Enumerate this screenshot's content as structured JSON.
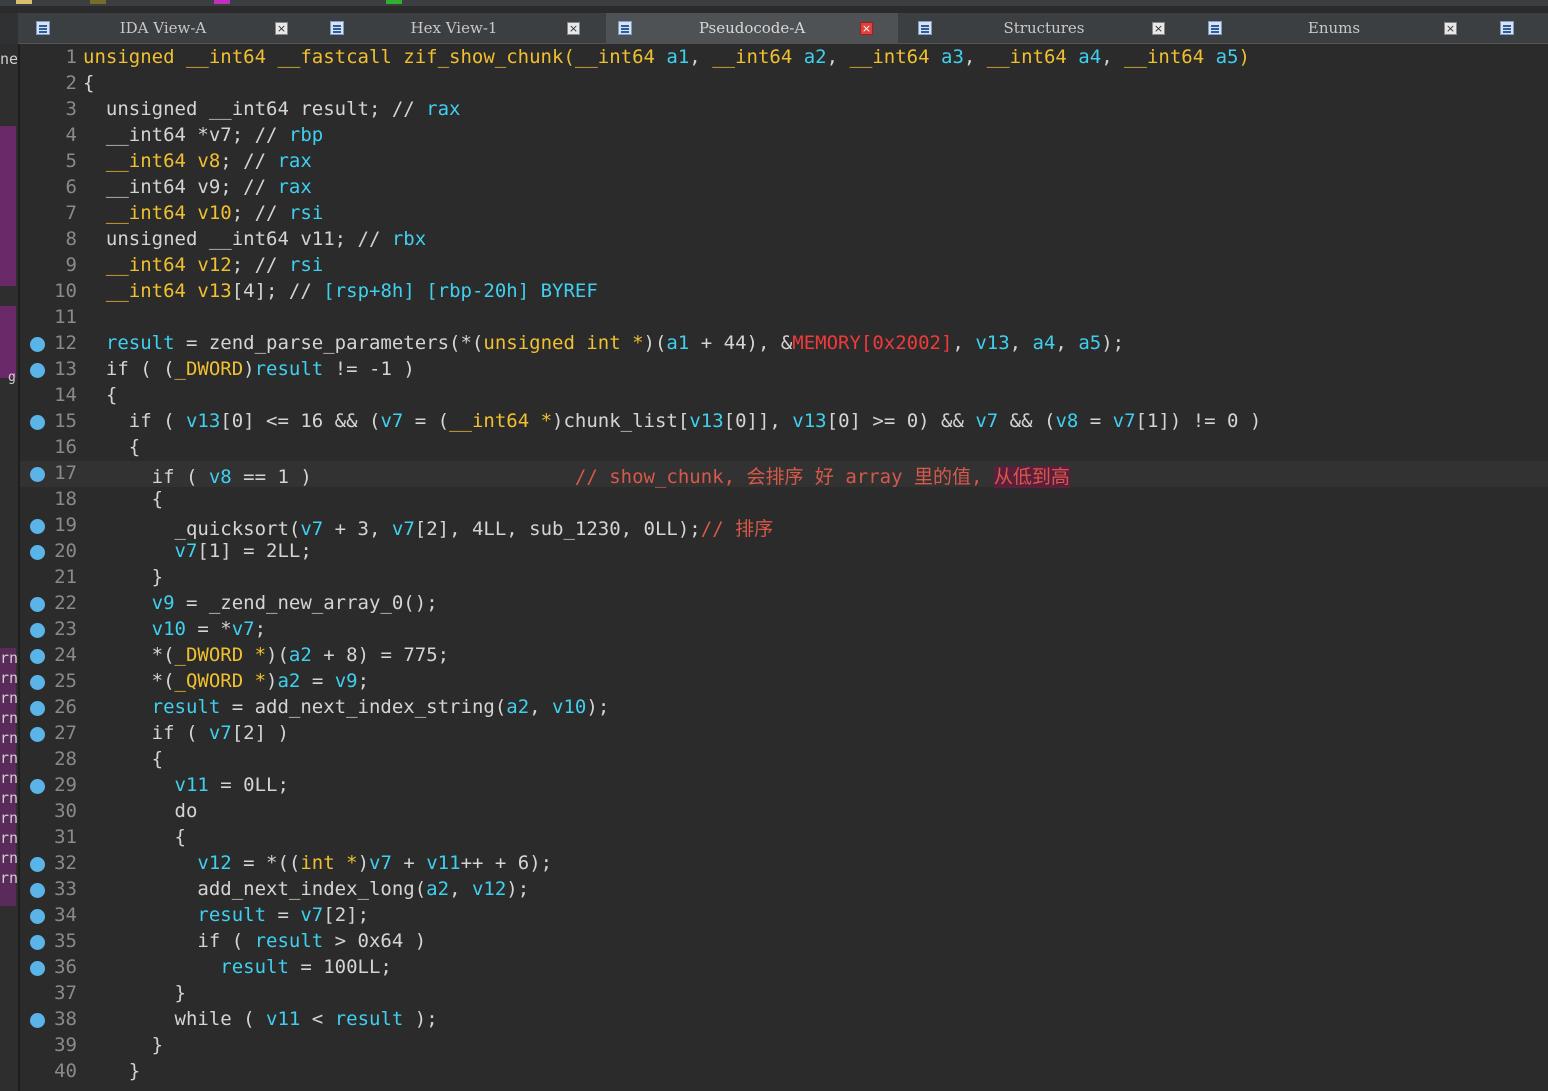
{
  "colors": {
    "background": "#2b2b2b",
    "keyword": "#f0c030",
    "variable": "#3fd0f0",
    "text": "#d4d4d4",
    "memory": "#f03a3a",
    "comment": "#d8584a",
    "breakpoint": "#5ab4e8"
  },
  "tabs": [
    {
      "label": "IDA View-A",
      "icon": "disassembly-icon",
      "active": false
    },
    {
      "label": "Hex View-1",
      "icon": "hex-icon",
      "active": false
    },
    {
      "label": "Pseudocode-A",
      "icon": "pseudocode-icon",
      "active": true
    },
    {
      "label": "Structures",
      "icon": "structures-icon",
      "active": false
    },
    {
      "label": "Enums",
      "icon": "enums-icon",
      "active": false
    }
  ],
  "left_panel_fragments": [
    "ne",
    "g",
    "rn",
    "rn",
    "rn",
    "rn",
    "rn",
    "rn",
    "rn",
    "rn",
    "rn",
    "rn",
    "rn",
    "rn"
  ],
  "code_lines": [
    {
      "n": "1",
      "dot": false,
      "tokens": [
        [
          "y",
          "unsigned __int64 __fastcall zif_show_chunk("
        ],
        [
          "y",
          "__int64 "
        ],
        [
          "c",
          "a1"
        ],
        [
          "w",
          ", "
        ],
        [
          "y",
          "__int64 "
        ],
        [
          "c",
          "a2"
        ],
        [
          "w",
          ", "
        ],
        [
          "y",
          "__int64 "
        ],
        [
          "c",
          "a3"
        ],
        [
          "w",
          ", "
        ],
        [
          "y",
          "__int64 "
        ],
        [
          "c",
          "a4"
        ],
        [
          "w",
          ", "
        ],
        [
          "y",
          "__int64 "
        ],
        [
          "c",
          "a5"
        ],
        [
          "y",
          ")"
        ]
      ]
    },
    {
      "n": "2",
      "dot": false,
      "tokens": [
        [
          "w",
          "{"
        ]
      ]
    },
    {
      "n": "3",
      "dot": false,
      "tokens": [
        [
          "w",
          "  unsigned __int64 result; // "
        ],
        [
          "c",
          "rax"
        ]
      ]
    },
    {
      "n": "4",
      "dot": false,
      "tokens": [
        [
          "w",
          "  __int64 *v7; // "
        ],
        [
          "c",
          "rbp"
        ]
      ]
    },
    {
      "n": "5",
      "dot": false,
      "tokens": [
        [
          "w",
          "  "
        ],
        [
          "y",
          "__int64 v8"
        ],
        [
          "w",
          "; // "
        ],
        [
          "c",
          "rax"
        ]
      ]
    },
    {
      "n": "6",
      "dot": false,
      "tokens": [
        [
          "w",
          "  __int64 v9; // "
        ],
        [
          "c",
          "rax"
        ]
      ]
    },
    {
      "n": "7",
      "dot": false,
      "tokens": [
        [
          "w",
          "  "
        ],
        [
          "y",
          "__int64 v10"
        ],
        [
          "w",
          "; // "
        ],
        [
          "c",
          "rsi"
        ]
      ]
    },
    {
      "n": "8",
      "dot": false,
      "tokens": [
        [
          "w",
          "  unsigned __int64 v11; // "
        ],
        [
          "c",
          "rbx"
        ]
      ]
    },
    {
      "n": "9",
      "dot": false,
      "tokens": [
        [
          "w",
          "  "
        ],
        [
          "y",
          "__int64 v12"
        ],
        [
          "w",
          "; // "
        ],
        [
          "c",
          "rsi"
        ]
      ]
    },
    {
      "n": "10",
      "dot": false,
      "tokens": [
        [
          "w",
          "  "
        ],
        [
          "y",
          "__int64 v13"
        ],
        [
          "w",
          "[4]; // "
        ],
        [
          "c",
          "[rsp+8h] [rbp-20h] BYREF"
        ]
      ]
    },
    {
      "n": "11",
      "dot": false,
      "tokens": [
        [
          "w",
          ""
        ]
      ]
    },
    {
      "n": "12",
      "dot": true,
      "tokens": [
        [
          "c",
          "  result"
        ],
        [
          "w",
          " = zend_parse_parameters(*("
        ],
        [
          "y",
          "unsigned int *"
        ],
        [
          "w",
          ")("
        ],
        [
          "c",
          "a1"
        ],
        [
          "w",
          " + 44), &"
        ],
        [
          "r",
          "MEMORY[0x2002]"
        ],
        [
          "w",
          ", "
        ],
        [
          "c",
          "v13"
        ],
        [
          "w",
          ", "
        ],
        [
          "c",
          "a4"
        ],
        [
          "w",
          ", "
        ],
        [
          "c",
          "a5"
        ],
        [
          "w",
          ");"
        ]
      ]
    },
    {
      "n": "13",
      "dot": true,
      "tokens": [
        [
          "w",
          "  if ( ("
        ],
        [
          "y",
          "_DWORD"
        ],
        [
          "w",
          ")"
        ],
        [
          "c",
          "result"
        ],
        [
          "w",
          " != -1 )"
        ]
      ]
    },
    {
      "n": "14",
      "dot": false,
      "tokens": [
        [
          "w",
          "  {"
        ]
      ]
    },
    {
      "n": "15",
      "dot": true,
      "tokens": [
        [
          "w",
          "    if ( "
        ],
        [
          "c",
          "v13"
        ],
        [
          "w",
          "[0] <= 16 && ("
        ],
        [
          "c",
          "v7"
        ],
        [
          "w",
          " = ("
        ],
        [
          "y",
          "__int64 *"
        ],
        [
          "w",
          ")chunk_list["
        ],
        [
          "c",
          "v13"
        ],
        [
          "w",
          "[0]], "
        ],
        [
          "c",
          "v13"
        ],
        [
          "w",
          "[0] >= 0) && "
        ],
        [
          "c",
          "v7"
        ],
        [
          "w",
          " && ("
        ],
        [
          "c",
          "v8"
        ],
        [
          "w",
          " = "
        ],
        [
          "c",
          "v7"
        ],
        [
          "w",
          "[1]) != 0 )"
        ]
      ]
    },
    {
      "n": "16",
      "dot": false,
      "tokens": [
        [
          "w",
          "    {"
        ]
      ]
    },
    {
      "n": "17",
      "dot": true,
      "hl": true,
      "tokens": [
        [
          "w",
          "      if ( "
        ],
        [
          "c",
          "v8"
        ],
        [
          "w",
          " == 1 )                       "
        ],
        [
          "cm",
          "// show_chunk, 会排序 好 array 里的值, "
        ],
        [
          "cmhl",
          "从低到高"
        ]
      ]
    },
    {
      "n": "18",
      "dot": false,
      "tokens": [
        [
          "w",
          "      {"
        ]
      ]
    },
    {
      "n": "19",
      "dot": true,
      "tokens": [
        [
          "w",
          "        _quicksort("
        ],
        [
          "c",
          "v7"
        ],
        [
          "w",
          " + 3, "
        ],
        [
          "c",
          "v7"
        ],
        [
          "w",
          "[2], 4LL, sub_1230, 0LL);"
        ],
        [
          "cm",
          "// 排序"
        ]
      ]
    },
    {
      "n": "20",
      "dot": true,
      "tokens": [
        [
          "w",
          "        "
        ],
        [
          "c",
          "v7"
        ],
        [
          "w",
          "[1] = 2LL;"
        ]
      ]
    },
    {
      "n": "21",
      "dot": false,
      "tokens": [
        [
          "w",
          "      }"
        ]
      ]
    },
    {
      "n": "22",
      "dot": true,
      "tokens": [
        [
          "w",
          "      "
        ],
        [
          "c",
          "v9"
        ],
        [
          "w",
          " = _zend_new_array_0();"
        ]
      ]
    },
    {
      "n": "23",
      "dot": true,
      "tokens": [
        [
          "w",
          "      "
        ],
        [
          "c",
          "v10"
        ],
        [
          "w",
          " = *"
        ],
        [
          "c",
          "v7"
        ],
        [
          "w",
          ";"
        ]
      ]
    },
    {
      "n": "24",
      "dot": true,
      "tokens": [
        [
          "w",
          "      *("
        ],
        [
          "y",
          "_DWORD *"
        ],
        [
          "w",
          ")("
        ],
        [
          "c",
          "a2"
        ],
        [
          "w",
          " + 8) = 775;"
        ]
      ]
    },
    {
      "n": "25",
      "dot": true,
      "tokens": [
        [
          "w",
          "      *("
        ],
        [
          "y",
          "_QWORD *"
        ],
        [
          "w",
          ")"
        ],
        [
          "c",
          "a2"
        ],
        [
          "w",
          " = "
        ],
        [
          "c",
          "v9"
        ],
        [
          "w",
          ";"
        ]
      ]
    },
    {
      "n": "26",
      "dot": true,
      "tokens": [
        [
          "w",
          "      "
        ],
        [
          "c",
          "result"
        ],
        [
          "w",
          " = add_next_index_string("
        ],
        [
          "c",
          "a2"
        ],
        [
          "w",
          ", "
        ],
        [
          "c",
          "v10"
        ],
        [
          "w",
          ");"
        ]
      ]
    },
    {
      "n": "27",
      "dot": true,
      "tokens": [
        [
          "w",
          "      if ( "
        ],
        [
          "c",
          "v7"
        ],
        [
          "w",
          "[2] )"
        ]
      ]
    },
    {
      "n": "28",
      "dot": false,
      "tokens": [
        [
          "w",
          "      {"
        ]
      ]
    },
    {
      "n": "29",
      "dot": true,
      "tokens": [
        [
          "w",
          "        "
        ],
        [
          "c",
          "v11"
        ],
        [
          "w",
          " = 0LL;"
        ]
      ]
    },
    {
      "n": "30",
      "dot": false,
      "tokens": [
        [
          "w",
          "        do"
        ]
      ]
    },
    {
      "n": "31",
      "dot": false,
      "tokens": [
        [
          "w",
          "        {"
        ]
      ]
    },
    {
      "n": "32",
      "dot": true,
      "tokens": [
        [
          "w",
          "          "
        ],
        [
          "c",
          "v12"
        ],
        [
          "w",
          " = *(("
        ],
        [
          "y",
          "int *"
        ],
        [
          "w",
          ")"
        ],
        [
          "c",
          "v7"
        ],
        [
          "w",
          " + "
        ],
        [
          "c",
          "v11"
        ],
        [
          "w",
          "++ + 6);"
        ]
      ]
    },
    {
      "n": "33",
      "dot": true,
      "tokens": [
        [
          "w",
          "          add_next_index_long("
        ],
        [
          "c",
          "a2"
        ],
        [
          "w",
          ", "
        ],
        [
          "c",
          "v12"
        ],
        [
          "w",
          ");"
        ]
      ]
    },
    {
      "n": "34",
      "dot": true,
      "tokens": [
        [
          "w",
          "          "
        ],
        [
          "c",
          "result"
        ],
        [
          "w",
          " = "
        ],
        [
          "c",
          "v7"
        ],
        [
          "w",
          "[2];"
        ]
      ]
    },
    {
      "n": "35",
      "dot": true,
      "tokens": [
        [
          "w",
          "          if ( "
        ],
        [
          "c",
          "result"
        ],
        [
          "w",
          " > 0x64 )"
        ]
      ]
    },
    {
      "n": "36",
      "dot": true,
      "tokens": [
        [
          "w",
          "            "
        ],
        [
          "c",
          "result"
        ],
        [
          "w",
          " = 100LL;"
        ]
      ]
    },
    {
      "n": "37",
      "dot": false,
      "tokens": [
        [
          "w",
          "        }"
        ]
      ]
    },
    {
      "n": "38",
      "dot": true,
      "tokens": [
        [
          "w",
          "        while ( "
        ],
        [
          "c",
          "v11"
        ],
        [
          "w",
          " < "
        ],
        [
          "c",
          "result"
        ],
        [
          "w",
          " );"
        ]
      ]
    },
    {
      "n": "39",
      "dot": false,
      "tokens": [
        [
          "w",
          "      }"
        ]
      ]
    },
    {
      "n": "40",
      "dot": false,
      "tokens": [
        [
          "w",
          "    }"
        ]
      ]
    }
  ]
}
